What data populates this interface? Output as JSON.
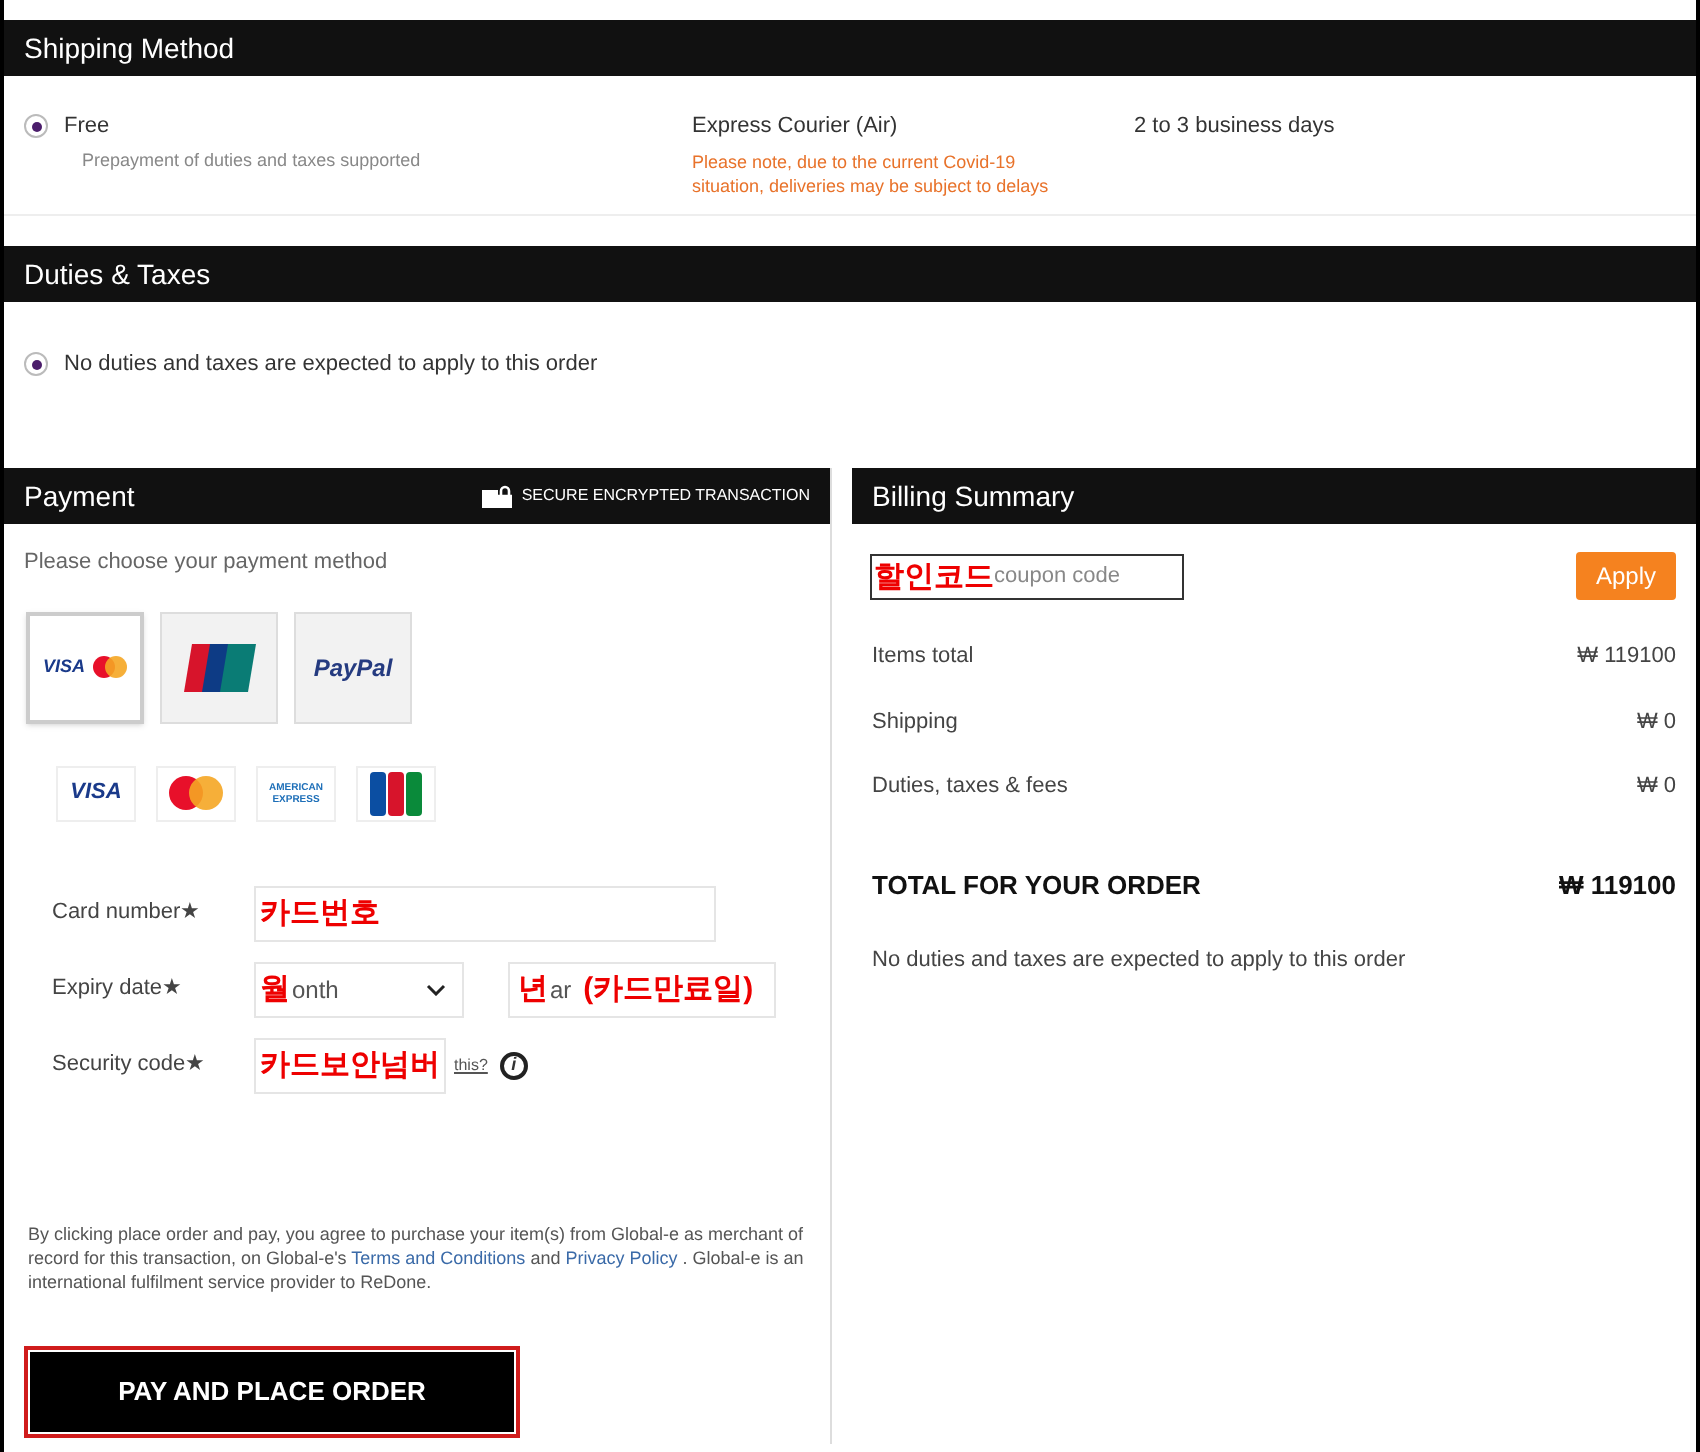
{
  "shipping": {
    "title": "Shipping Method",
    "options": [
      {
        "label": "Free",
        "note": "Prepayment of duties and taxes supported",
        "carrier": "Express Courier (Air)",
        "warning": "Please note, due to the current Covid-19 situation, deliveries may be subject to delays",
        "time": "2 to 3 business days",
        "selected": true
      }
    ]
  },
  "duties": {
    "title": "Duties & Taxes",
    "options": [
      {
        "label": "No duties and taxes are expected to apply to this order",
        "selected": true
      }
    ]
  },
  "payment": {
    "title": "Payment",
    "secure_label": "SECURE ENCRYPTED TRANSACTION",
    "prompt": "Please choose your payment method",
    "methods": [
      {
        "kind": "cards",
        "label": "VISA",
        "selected": true
      },
      {
        "kind": "unionpay",
        "selected": false
      },
      {
        "kind": "paypal",
        "label": "PayPal",
        "selected": false
      }
    ],
    "brands": [
      {
        "kind": "visa",
        "label": "VISA"
      },
      {
        "kind": "mastercard"
      },
      {
        "kind": "amex",
        "label": "AMERICAN EXPRESS"
      },
      {
        "kind": "jcb"
      }
    ],
    "fields": [
      {
        "kind": "card",
        "label": "Card number",
        "required": "★",
        "annotation": "카드번호"
      },
      {
        "kind": "expiry",
        "label": "Expiry date",
        "required": "★",
        "annotation": "월",
        "placeholder": "onth",
        "year_annotation": "년",
        "year_placeholder": "ar",
        "year_note": "(카드만료일)"
      },
      {
        "kind": "security",
        "label": "Security code",
        "required": "★",
        "annotation": "카드보안넘버",
        "link": "this?",
        "info": "i"
      }
    ],
    "legal": {
      "before": "By clicking place order and pay, you agree to purchase your item(s) from Global-e as merchant of record for this transaction, on Global-e's ",
      "link1": "Terms and Conditions",
      "middle": " and ",
      "link2": "Privacy Policy",
      "after": " . Global-e is an international fulfilment service provider to ReDone."
    },
    "button": "PAY AND PLACE ORDER"
  },
  "billing": {
    "title": "Billing Summary",
    "coupon": {
      "annotation": "할인코드",
      "placeholder": "coupon code"
    },
    "apply": "Apply",
    "rows": [
      {
        "label": "Items total",
        "value": "₩ 119100"
      },
      {
        "label": "Shipping",
        "value": "₩ 0"
      },
      {
        "label": "Duties, taxes & fees",
        "value": "₩ 0"
      }
    ],
    "total": {
      "label": "TOTAL FOR YOUR ORDER",
      "value": "₩ 119100"
    },
    "note": "No duties and taxes are expected to apply to this order"
  }
}
